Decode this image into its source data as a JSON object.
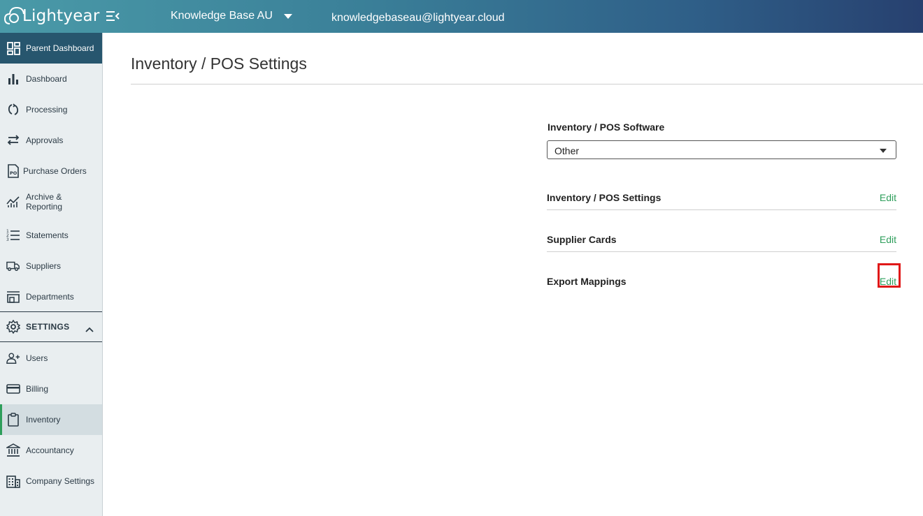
{
  "header": {
    "logo_text": "Lightyear",
    "company": "Knowledge Base AU",
    "email": "knowledgebaseau@lightyear.cloud"
  },
  "sidebar": {
    "parent_dashboard": "Parent Dashboard",
    "items": [
      {
        "label": "Dashboard",
        "icon": "bar-chart-icon"
      },
      {
        "label": "Processing",
        "icon": "refresh-icon"
      },
      {
        "label": "Approvals",
        "icon": "swap-arrows-icon"
      },
      {
        "label": "Purchase Orders",
        "icon": "po-document-icon"
      },
      {
        "label": "Archive & Reporting",
        "icon": "line-chart-icon"
      },
      {
        "label": "Statements",
        "icon": "numbered-list-icon"
      },
      {
        "label": "Suppliers",
        "icon": "truck-icon"
      },
      {
        "label": "Departments",
        "icon": "storefront-icon"
      }
    ],
    "settings_label": "SETTINGS",
    "settings_items": [
      {
        "label": "Users",
        "icon": "add-user-icon"
      },
      {
        "label": "Billing",
        "icon": "credit-card-icon"
      },
      {
        "label": "Inventory",
        "icon": "clipboard-icon",
        "active": true
      },
      {
        "label": "Accountancy",
        "icon": "bank-icon"
      },
      {
        "label": "Company Settings",
        "icon": "building-icon"
      }
    ]
  },
  "main": {
    "title": "Inventory / POS Settings",
    "software_label": "Inventory / POS Software",
    "software_value": "Other",
    "rows": [
      {
        "label": "Inventory / POS Settings",
        "action": "Edit"
      },
      {
        "label": "Supplier Cards",
        "action": "Edit"
      },
      {
        "label": "Export Mappings",
        "action": "Edit"
      }
    ]
  },
  "colors": {
    "accent": "#2e9e5b",
    "sidebar_active": "#27566e",
    "highlight": "#e01818"
  }
}
